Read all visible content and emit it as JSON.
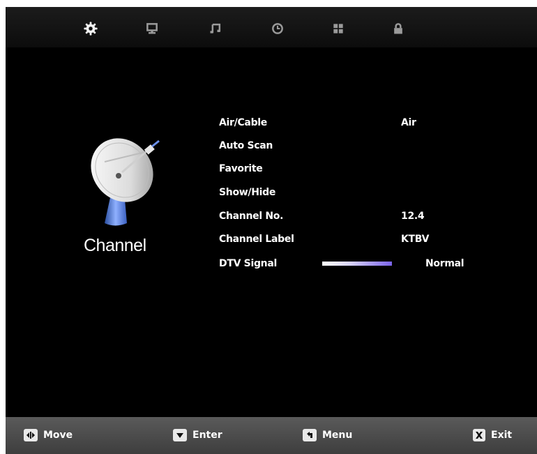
{
  "tabs": [
    {
      "icon": "gear-icon",
      "active": true
    },
    {
      "icon": "monitor-icon",
      "active": false
    },
    {
      "icon": "music-note-icon",
      "active": false
    },
    {
      "icon": "clock-icon",
      "active": false
    },
    {
      "icon": "grid-icon",
      "active": false
    },
    {
      "icon": "lock-icon",
      "active": false
    }
  ],
  "section": {
    "title": "Channel",
    "icon": "satellite-dish-icon"
  },
  "menu": {
    "air_cable": {
      "label": "Air/Cable",
      "value": "Air"
    },
    "auto_scan": {
      "label": "Auto Scan"
    },
    "favorite": {
      "label": "Favorite"
    },
    "show_hide": {
      "label": "Show/Hide"
    },
    "channel_no": {
      "label": "Channel No.",
      "value": "12.4"
    },
    "channel_label": {
      "label": "Channel Label",
      "value": "KTBV"
    },
    "dtv_signal": {
      "label": "DTV Signal",
      "value": "Normal"
    }
  },
  "footer": {
    "move": "Move",
    "enter": "Enter",
    "menu": "Menu",
    "exit": "Exit"
  },
  "colors": {
    "background": "#000000",
    "text": "#ffffff",
    "signal_bar_end": "#7a63e8",
    "footer_bg": "#4a4a4a"
  }
}
